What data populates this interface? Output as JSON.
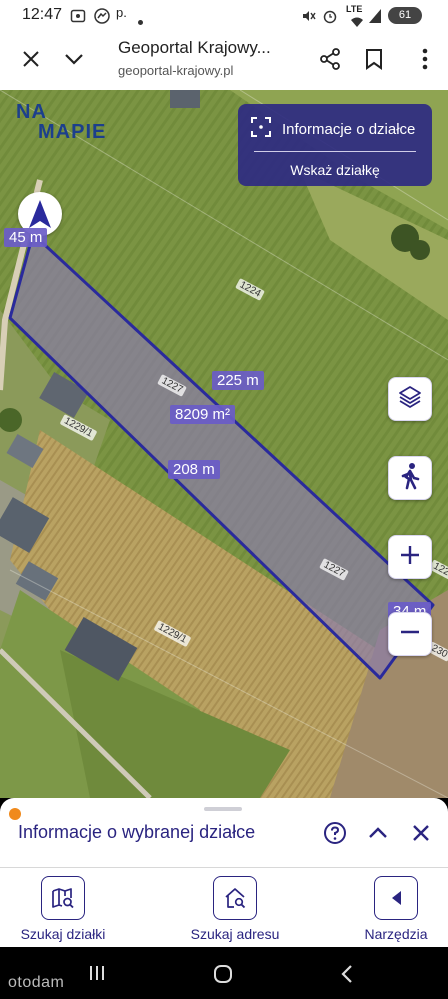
{
  "status_bar": {
    "time": "12:47",
    "left_icons": [
      "screenshot-icon",
      "messenger-icon",
      "p-notification-icon",
      "dot-icon"
    ],
    "p_text": "p.",
    "network": "LTE",
    "battery": "61",
    "right_icons": [
      "mute-icon",
      "alarm-icon",
      "wifi-icon",
      "signal-icon",
      "battery-icon"
    ]
  },
  "browser": {
    "title": "Geoportal Krajowy...",
    "url": "geoportal-krajowy.pl",
    "icons": [
      "close-icon",
      "chevron-down-icon",
      "share-icon",
      "bookmark-icon",
      "more-icon"
    ]
  },
  "map": {
    "logo_line1": "NA",
    "logo_line2": "MAPIE",
    "info_panel": {
      "title": "Informacje o działce",
      "action": "Wskaż działkę"
    },
    "labels": {
      "width_top": "45 m",
      "length_top": "225 m",
      "area": "8209 m²",
      "length_bottom": "208 m",
      "width_bottom": "34 m"
    },
    "parcel_numbers": [
      "1224",
      "1227",
      "1229/1",
      "1227",
      "1229/1",
      "122",
      "230"
    ],
    "buttons": [
      "layers-icon",
      "street-view-icon",
      "zoom-in-icon",
      "zoom-out-icon"
    ],
    "colors": {
      "parcel_outline": "#2a2a9c",
      "parcel_fill": "#8a7fa0",
      "label_bg": "#6a5cc8"
    }
  },
  "sheet": {
    "title": "Informacje o wybranej działce",
    "icons": [
      "help-icon",
      "chevron-up-icon",
      "close-icon"
    ]
  },
  "toolbar": {
    "items": [
      {
        "label": "Szukaj działki",
        "icon": "map-search-icon"
      },
      {
        "label": "Szukaj adresu",
        "icon": "home-search-icon"
      },
      {
        "label": "Narzędzia",
        "icon": "tools-icon"
      }
    ],
    "accent": "#2a2480"
  },
  "nav": {
    "brand": "otodam",
    "icons": [
      "recents-icon",
      "home-icon",
      "back-icon"
    ]
  }
}
